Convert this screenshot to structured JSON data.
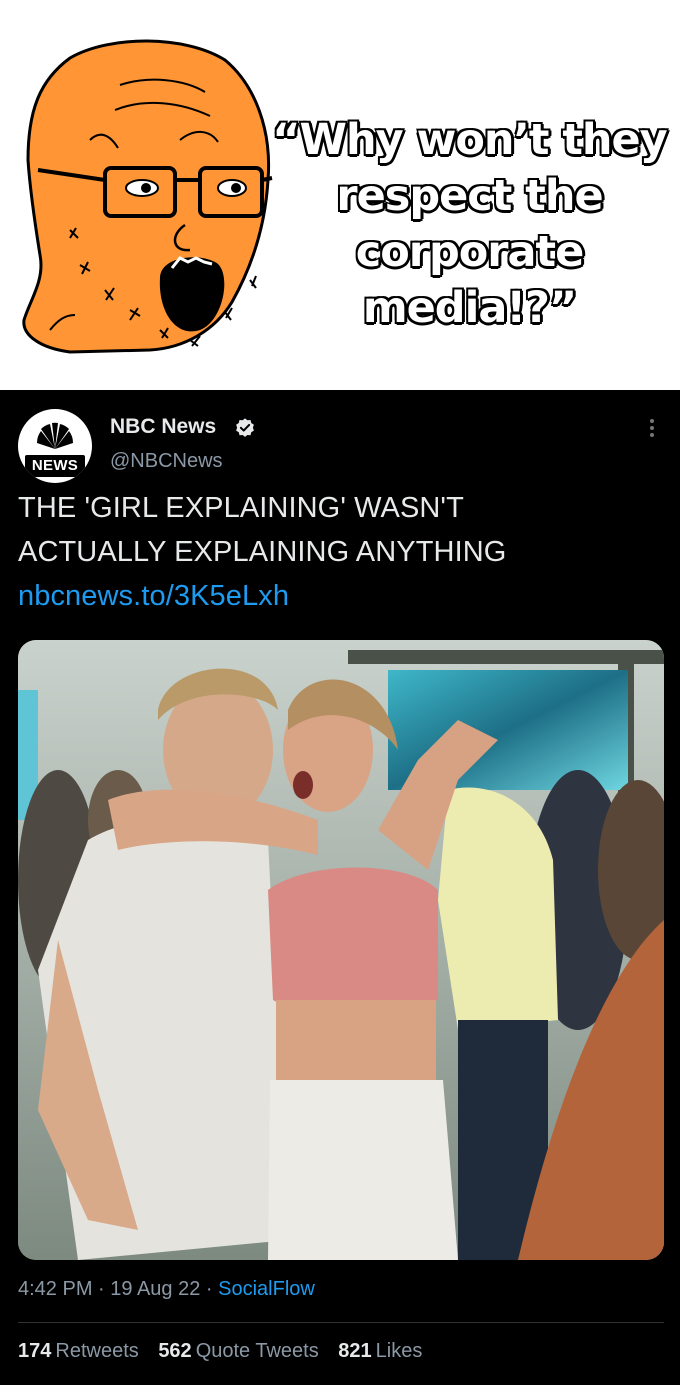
{
  "meme": {
    "caption_lines": [
      "“Why won’t they",
      "respect the",
      "corporate media!?”"
    ],
    "face_color": "#ff9535"
  },
  "tweet": {
    "display_name": "NBC News",
    "handle": "@NBCNews",
    "avatar_label": "NEWS",
    "verified_icon": "verified-badge-icon",
    "text_lines": [
      "THE 'GIRL EXPLAINING' WASN'T",
      "ACTUALLY EXPLAINING ANYTHING"
    ],
    "link": "nbcnews.to/3K5eLxh",
    "time": "4:42 PM",
    "date": "19 Aug 22",
    "source": "SocialFlow",
    "stats": {
      "retweets_count": "174",
      "retweets_label": "Retweets",
      "quotes_count": "562",
      "quotes_label": "Quote Tweets",
      "likes_count": "821",
      "likes_label": "Likes"
    },
    "colors": {
      "link": "#1d9bf0",
      "muted": "#8b98a5",
      "text": "#e7e9ea"
    }
  }
}
